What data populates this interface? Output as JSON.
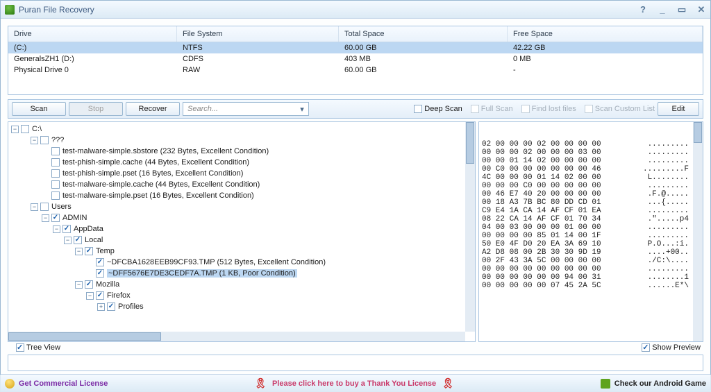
{
  "title": "Puran File Recovery",
  "drives": {
    "headers": {
      "drive": "Drive",
      "fs": "File System",
      "total": "Total Space",
      "free": "Free Space"
    },
    "rows": [
      {
        "drive": "(C:)",
        "fs": "NTFS",
        "total": "60.00 GB",
        "free": "42.22 GB"
      },
      {
        "drive": "GeneralsZH1 (D:)",
        "fs": "CDFS",
        "total": "403 MB",
        "free": "0 MB"
      },
      {
        "drive": "Physical Drive 0",
        "fs": "RAW",
        "total": "60.00 GB",
        "free": "-"
      }
    ]
  },
  "toolbar": {
    "scan": "Scan",
    "stop": "Stop",
    "recover": "Recover",
    "edit": "Edit",
    "search_placeholder": "Search...",
    "deep_scan": "Deep Scan",
    "full_scan": "Full Scan",
    "find_lost": "Find lost files",
    "custom_list": "Scan Custom List"
  },
  "tree": {
    "root": "C:\\",
    "unknown": "???",
    "files_q": [
      "test-malware-simple.sbstore  (232 Bytes, Excellent Condition)",
      "test-phish-simple.cache  (44 Bytes, Excellent Condition)",
      "test-phish-simple.pset  (16 Bytes, Excellent Condition)",
      "test-malware-simple.cache  (44 Bytes, Excellent Condition)",
      "test-malware-simple.pset  (16 Bytes, Excellent Condition)"
    ],
    "users": "Users",
    "admin": "ADMIN",
    "appdata": "AppData",
    "local": "Local",
    "temp": "Temp",
    "tmp1": "~DFCBA1628EEB99CF93.TMP  (512 Bytes, Excellent Condition)",
    "tmp2": "~DFF5676E7DE3CEDF7A.TMP  (1 KB, Poor Condition)",
    "mozilla": "Mozilla",
    "firefox": "Firefox",
    "profiles": "Profiles"
  },
  "hex": [
    [
      "02 00 00 00 02 00 00 00 00",
      "........."
    ],
    [
      "00 00 00 02 00 00 00 03 00",
      "........."
    ],
    [
      "00 00 01 14 02 00 00 00 00",
      "........."
    ],
    [
      "00 C0 00 00 00 00 00 00 46",
      ".........F"
    ],
    [
      "4C 00 00 00 01 14 02 00 00",
      "L........"
    ],
    [
      "00 00 00 C0 00 00 00 00 00",
      "........."
    ],
    [
      "00 46 E7 40 20 00 00 00 00",
      ".F.@....."
    ],
    [
      "00 18 A3 7B BC 80 DD CD 01",
      "...{....."
    ],
    [
      "C9 E4 1A CA 14 AF CF 01 EA",
      "........."
    ],
    [
      "08 22 CA 14 AF CF 01 70 34",
      ".\".....p4"
    ],
    [
      "04 00 03 00 00 00 01 00 00",
      "........."
    ],
    [
      "00 00 00 00 85 01 14 00 1F",
      "........."
    ],
    [
      "50 E0 4F D0 20 EA 3A 69 10",
      "P.O...:i."
    ],
    [
      "A2 D8 08 00 2B 30 30 9D 19",
      "....+00.."
    ],
    [
      "00 2F 43 3A 5C 00 00 00 00",
      "./C:\\...."
    ],
    [
      "00 00 00 00 00 00 00 00 00",
      "........."
    ],
    [
      "00 00 00 00 00 00 94 00 31",
      "........1"
    ],
    [
      "00 00 00 00 00 07 45 2A 5C",
      "......E*\\"
    ]
  ],
  "footer": {
    "tree_view": "Tree View",
    "show_preview": "Show Preview"
  },
  "bottom": {
    "left": "Get Commercial License",
    "center": "Please click here to buy a Thank You License",
    "right": "Check our Android Game"
  }
}
